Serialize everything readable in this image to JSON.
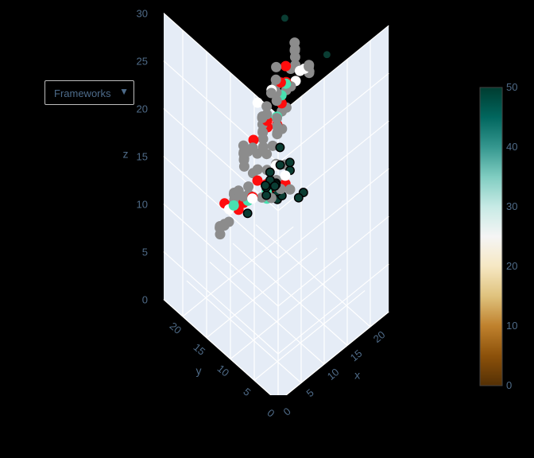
{
  "dropdown": {
    "label": "Frameworks",
    "caret_icon": "triangle-down-icon"
  },
  "chart_data": {
    "type": "scatter3d",
    "title": "",
    "scene": {
      "bgcolor": "#e5ecf6",
      "x_axis": {
        "title": "x",
        "ticks": [
          "0",
          "5",
          "10",
          "15",
          "20"
        ]
      },
      "y_axis": {
        "title": "y",
        "ticks": [
          "0",
          "5",
          "10",
          "15",
          "20"
        ]
      },
      "z_axis": {
        "title": "z",
        "ticks": [
          "0",
          "5",
          "10",
          "15",
          "20",
          "25",
          "30"
        ]
      },
      "range": {
        "x": [
          0,
          24
        ],
        "y": [
          0,
          24
        ],
        "z": [
          0,
          30
        ]
      }
    },
    "colorbar": {
      "min": 0,
      "max": 50,
      "ticks": [
        "0",
        "10",
        "20",
        "30",
        "40",
        "50"
      ],
      "colorscale": "BrBG"
    },
    "series": [
      {
        "color": "#8c8c8c",
        "points": [
          [
            4,
            5,
            23
          ],
          [
            5,
            5,
            24
          ],
          [
            6,
            5,
            24
          ],
          [
            7,
            6,
            25
          ],
          [
            8,
            6,
            25
          ],
          [
            9,
            7,
            26
          ],
          [
            10,
            7,
            26
          ],
          [
            11,
            8,
            27
          ],
          [
            12,
            8,
            27
          ],
          [
            13,
            9,
            27
          ],
          [
            14,
            10,
            27
          ],
          [
            15,
            11,
            26
          ],
          [
            16,
            12,
            26
          ],
          [
            4,
            7,
            22
          ],
          [
            5,
            8,
            22
          ],
          [
            6,
            9,
            22
          ],
          [
            7,
            10,
            21
          ],
          [
            8,
            11,
            21
          ],
          [
            9,
            12,
            21
          ],
          [
            10,
            13,
            20
          ],
          [
            11,
            13,
            20
          ],
          [
            12,
            14,
            20
          ],
          [
            13,
            14,
            21
          ],
          [
            14,
            14,
            22
          ],
          [
            6,
            6,
            23
          ],
          [
            7,
            7,
            23
          ],
          [
            8,
            8,
            23
          ],
          [
            9,
            9,
            24
          ],
          [
            10,
            10,
            24
          ],
          [
            11,
            11,
            24
          ],
          [
            12,
            12,
            25
          ],
          [
            3,
            10,
            19
          ],
          [
            4,
            11,
            19
          ],
          [
            5,
            12,
            18
          ],
          [
            6,
            13,
            18
          ],
          [
            7,
            14,
            17
          ],
          [
            8,
            15,
            17
          ],
          [
            9,
            15,
            16
          ],
          [
            10,
            15,
            16
          ],
          [
            11,
            15,
            15
          ],
          [
            12,
            14,
            15
          ],
          [
            13,
            13,
            14
          ],
          [
            14,
            12,
            14
          ],
          [
            4,
            13,
            13
          ],
          [
            5,
            14,
            13
          ],
          [
            6,
            15,
            12
          ],
          [
            7,
            16,
            12
          ],
          [
            8,
            17,
            11
          ],
          [
            9,
            17,
            11
          ],
          [
            10,
            17,
            10
          ],
          [
            11,
            16,
            10
          ],
          [
            12,
            15,
            10
          ],
          [
            13,
            14,
            10
          ],
          [
            14,
            13,
            11
          ],
          [
            15,
            12,
            11
          ],
          [
            6,
            12,
            14
          ],
          [
            7,
            13,
            14
          ],
          [
            8,
            13,
            15
          ],
          [
            9,
            13,
            15
          ],
          [
            10,
            12,
            15
          ],
          [
            11,
            11,
            14
          ],
          [
            5,
            17,
            8
          ],
          [
            6,
            18,
            8
          ],
          [
            7,
            19,
            7
          ],
          [
            8,
            19,
            7
          ],
          [
            9,
            20,
            6
          ],
          [
            10,
            20,
            6
          ],
          [
            14,
            7,
            26
          ],
          [
            15,
            8,
            25
          ],
          [
            16,
            9,
            25
          ],
          [
            17,
            10,
            24
          ]
        ]
      },
      {
        "color": "#ff0d0d",
        "points": [
          [
            6,
            6,
            24
          ],
          [
            8,
            7,
            25
          ],
          [
            10,
            8,
            26
          ],
          [
            7,
            9,
            22
          ],
          [
            9,
            11,
            21
          ],
          [
            12,
            10,
            26
          ],
          [
            5,
            10,
            21
          ],
          [
            13,
            12,
            23
          ],
          [
            10,
            14,
            13
          ],
          [
            12,
            13,
            12
          ],
          [
            14,
            12,
            12
          ],
          [
            8,
            15,
            11
          ],
          [
            11,
            16,
            10
          ],
          [
            9,
            17,
            9
          ],
          [
            13,
            15,
            11
          ],
          [
            7,
            18,
            10
          ]
        ]
      },
      {
        "color": "#48e0b0",
        "points": [
          [
            7,
            7,
            24
          ],
          [
            9,
            8,
            25
          ],
          [
            11,
            9,
            25
          ],
          [
            8,
            10,
            22
          ],
          [
            10,
            12,
            12
          ],
          [
            12,
            14,
            11
          ],
          [
            10,
            16,
            10
          ],
          [
            9,
            18,
            9
          ],
          [
            11,
            13,
            12
          ]
        ]
      },
      {
        "color": "#ffffff",
        "points": [
          [
            10,
            6,
            27
          ],
          [
            13,
            8,
            26
          ],
          [
            11,
            12,
            23
          ],
          [
            15,
            9,
            25
          ],
          [
            9,
            13,
            22
          ],
          [
            14,
            14,
            13
          ],
          [
            15,
            13,
            12
          ],
          [
            8,
            18,
            9
          ],
          [
            12,
            17,
            9
          ]
        ]
      },
      {
        "color": "#0a3d33",
        "points": [
          [
            18,
            16,
            26
          ],
          [
            23,
            12,
            22
          ],
          [
            5,
            5,
            17
          ],
          [
            5,
            6,
            17
          ],
          [
            6,
            5,
            17
          ],
          [
            6,
            6,
            17
          ],
          [
            5,
            5,
            18
          ],
          [
            6,
            6,
            18
          ],
          [
            15,
            12,
            13
          ],
          [
            16,
            13,
            13
          ],
          [
            12,
            13,
            12
          ],
          [
            13,
            13,
            12
          ],
          [
            14,
            14,
            11
          ],
          [
            17,
            16,
            11
          ],
          [
            18,
            17,
            12
          ],
          [
            14,
            16,
            9
          ],
          [
            15,
            17,
            9
          ],
          [
            12,
            18,
            7
          ],
          [
            21,
            15,
            7
          ],
          [
            21,
            16,
            6
          ],
          [
            20,
            22,
            5
          ],
          [
            21,
            21,
            5
          ],
          [
            20,
            21,
            6
          ],
          [
            21,
            22,
            6
          ]
        ]
      }
    ]
  }
}
